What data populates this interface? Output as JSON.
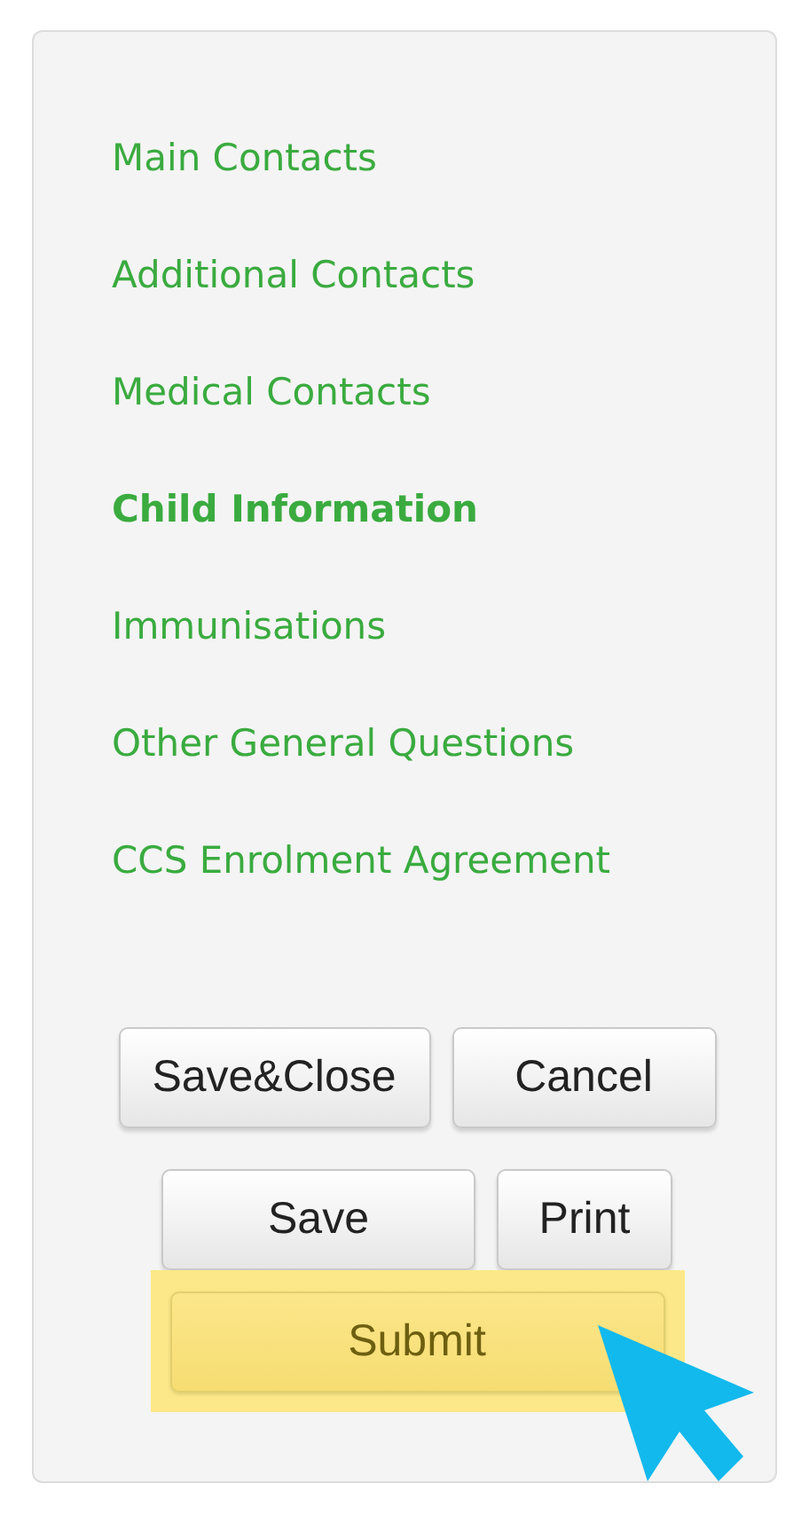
{
  "nav_links": [
    {
      "label": "Main Contacts",
      "selected": false
    },
    {
      "label": "Additional Contacts",
      "selected": false
    },
    {
      "label": "Medical Contacts",
      "selected": false
    },
    {
      "label": "Child Information",
      "selected": true
    },
    {
      "label": "Immunisations",
      "selected": false
    },
    {
      "label": "Other General Questions",
      "selected": false
    },
    {
      "label": "CCS Enrolment Agreement",
      "selected": false
    }
  ],
  "button_rows": [
    [
      {
        "label": "Save&Close",
        "kind": "plain"
      },
      {
        "label": "Cancel",
        "kind": "plain"
      }
    ],
    [
      {
        "label": "Save",
        "kind": "plain"
      },
      {
        "label": "Print",
        "kind": "plain"
      }
    ],
    [
      {
        "label": "Submit",
        "kind": "highlighted"
      }
    ]
  ]
}
